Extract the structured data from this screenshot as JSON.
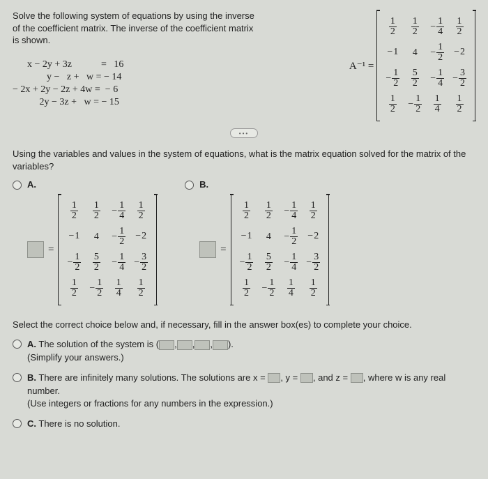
{
  "intro": "Solve the following system of equations by using the inverse of the coefficient matrix. The inverse of the coefficient matrix is shown.",
  "equations": [
    "      x − 2y + 3z            =   16",
    "              y −   z +   w = − 14",
    "− 2x + 2y − 2z + 4w =  − 6",
    "",
    "           2y − 3z +   w = − 15"
  ],
  "inv_label": "A⁻¹ =",
  "matrix": [
    [
      "1/2",
      "1/2",
      "−1/4",
      "1/2"
    ],
    [
      "−1",
      "4",
      "−1/2",
      "−2"
    ],
    [
      "−1/2",
      "5/2",
      "−1/4",
      "−3/2"
    ],
    [
      "1/2",
      "−1/2",
      "1/4",
      "1/2"
    ]
  ],
  "question": "Using the variables and values in the system of equations, what is the matrix equation solved for the matrix of the variables?",
  "optA": "A.",
  "optB": "B.",
  "eq_sign": "=",
  "select_text": "Select the correct choice below and, if necessary, fill in the answer box(es) to complete your choice.",
  "final": {
    "A1": "The solution of the system is (",
    "A2": ").",
    "A3": "(Simplify your answers.)",
    "B1": "There are infinitely many solutions. The solutions are x =",
    "B2": ", y =",
    "B3": ", and z =",
    "B4": ", where w is any real",
    "B5": "number.",
    "B6": "(Use integers or fractions for any numbers in the expression.)",
    "C1": "There is no solution."
  },
  "labels": {
    "A": "A.",
    "B": "B.",
    "C": "C."
  },
  "comma": ","
}
